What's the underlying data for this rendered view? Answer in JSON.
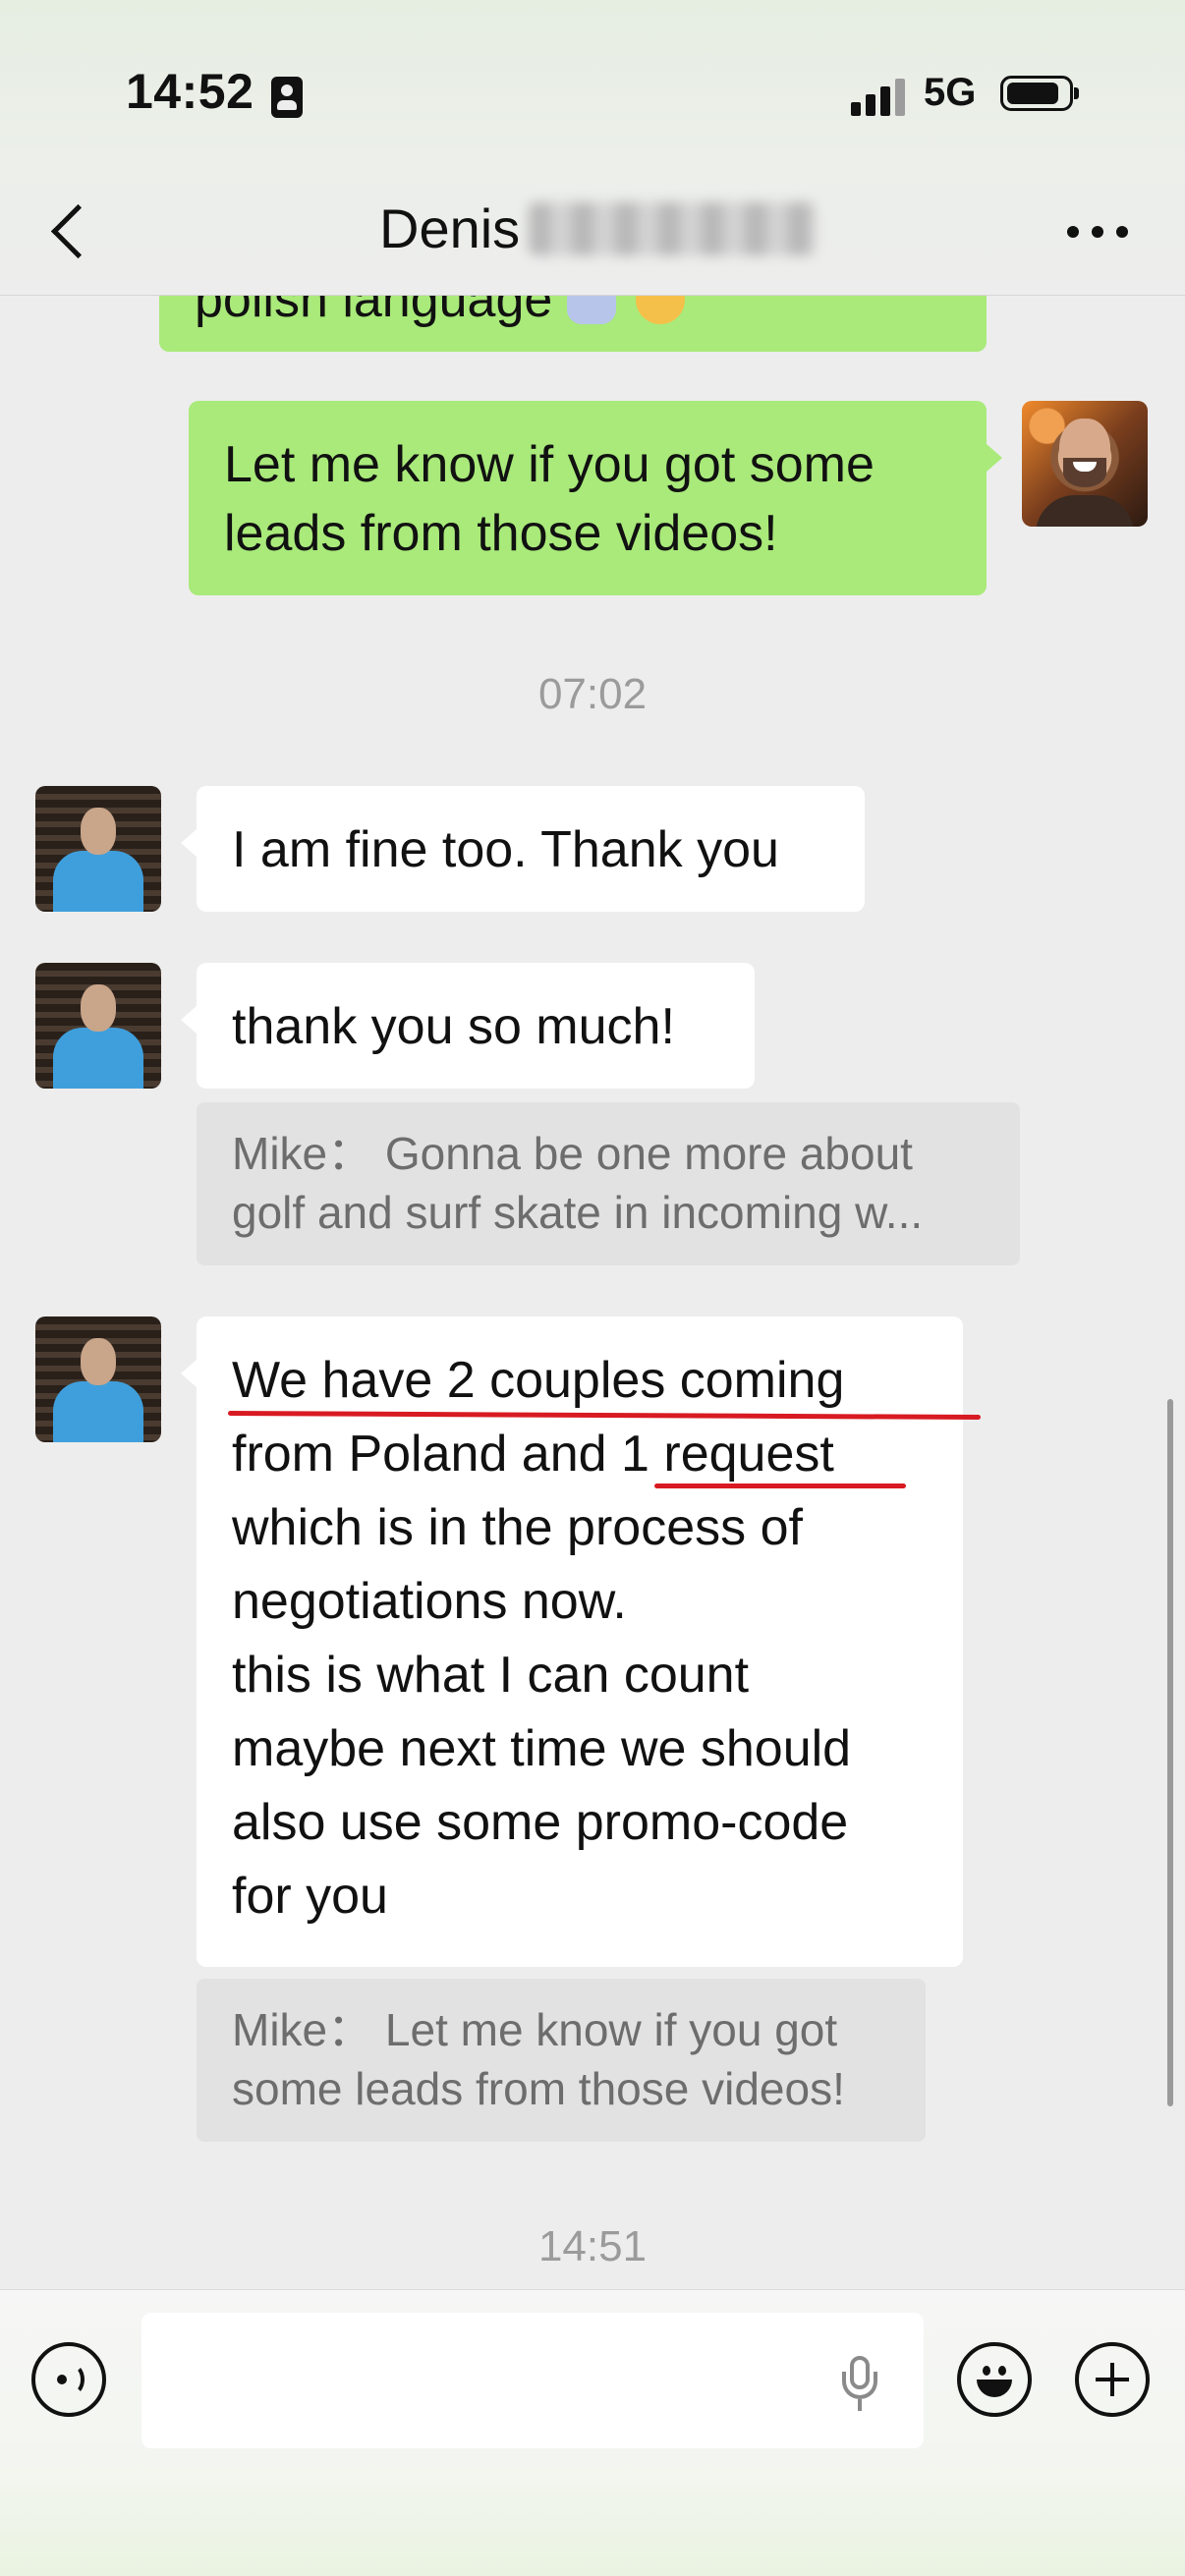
{
  "status_bar": {
    "time": "14:52",
    "network": "5G",
    "icons": [
      "id-card-icon",
      "signal-icon",
      "battery-icon"
    ]
  },
  "header": {
    "title": "Denis",
    "back_icon": "chevron-left-icon",
    "more_icon": "more-dots-icon"
  },
  "messages": {
    "partial_sent": "polish language",
    "sent_1": {
      "lines": [
        "Let me know if you got some",
        "leads from those videos!"
      ]
    },
    "timestamp_1": "07:02",
    "recv_1": "I am fine too. Thank you",
    "recv_2": "thank you so much!",
    "quote_1": {
      "lines": [
        "Mike： Gonna be one more about",
        "golf and surf skate in incoming w..."
      ]
    },
    "recv_3": {
      "lines": [
        "We have 2 couples coming",
        "from Poland and 1 request",
        "which is in the process of",
        "negotiations now.",
        "this is what I can count",
        "maybe next time we should",
        "also use some promo-code",
        "for you"
      ],
      "annotation_color": "#d81a22"
    },
    "quote_2": {
      "lines": [
        "Mike： Let me know if you got",
        "some leads from those videos!"
      ]
    },
    "timestamp_2": "14:51"
  },
  "input_bar": {
    "text_value": "",
    "voice_icon": "voice-mode-icon",
    "mic_icon": "microphone-icon",
    "emoji_icon": "emoji-icon",
    "add_icon": "plus-icon"
  },
  "colors": {
    "sent_bubble": "#a9ea7a",
    "recv_bubble": "#ffffff",
    "quote_bg": "#e2e2e2",
    "background": "#ededed"
  }
}
